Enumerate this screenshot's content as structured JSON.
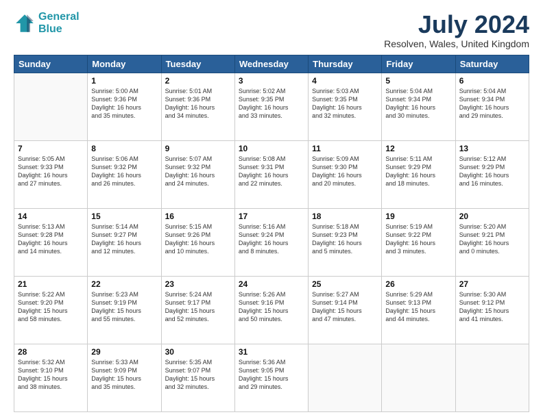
{
  "header": {
    "logo_line1": "General",
    "logo_line2": "Blue",
    "month": "July 2024",
    "location": "Resolven, Wales, United Kingdom"
  },
  "days_of_week": [
    "Sunday",
    "Monday",
    "Tuesday",
    "Wednesday",
    "Thursday",
    "Friday",
    "Saturday"
  ],
  "weeks": [
    [
      {
        "day": "",
        "content": ""
      },
      {
        "day": "1",
        "content": "Sunrise: 5:00 AM\nSunset: 9:36 PM\nDaylight: 16 hours\nand 35 minutes."
      },
      {
        "day": "2",
        "content": "Sunrise: 5:01 AM\nSunset: 9:36 PM\nDaylight: 16 hours\nand 34 minutes."
      },
      {
        "day": "3",
        "content": "Sunrise: 5:02 AM\nSunset: 9:35 PM\nDaylight: 16 hours\nand 33 minutes."
      },
      {
        "day": "4",
        "content": "Sunrise: 5:03 AM\nSunset: 9:35 PM\nDaylight: 16 hours\nand 32 minutes."
      },
      {
        "day": "5",
        "content": "Sunrise: 5:04 AM\nSunset: 9:34 PM\nDaylight: 16 hours\nand 30 minutes."
      },
      {
        "day": "6",
        "content": "Sunrise: 5:04 AM\nSunset: 9:34 PM\nDaylight: 16 hours\nand 29 minutes."
      }
    ],
    [
      {
        "day": "7",
        "content": "Sunrise: 5:05 AM\nSunset: 9:33 PM\nDaylight: 16 hours\nand 27 minutes."
      },
      {
        "day": "8",
        "content": "Sunrise: 5:06 AM\nSunset: 9:32 PM\nDaylight: 16 hours\nand 26 minutes."
      },
      {
        "day": "9",
        "content": "Sunrise: 5:07 AM\nSunset: 9:32 PM\nDaylight: 16 hours\nand 24 minutes."
      },
      {
        "day": "10",
        "content": "Sunrise: 5:08 AM\nSunset: 9:31 PM\nDaylight: 16 hours\nand 22 minutes."
      },
      {
        "day": "11",
        "content": "Sunrise: 5:09 AM\nSunset: 9:30 PM\nDaylight: 16 hours\nand 20 minutes."
      },
      {
        "day": "12",
        "content": "Sunrise: 5:11 AM\nSunset: 9:29 PM\nDaylight: 16 hours\nand 18 minutes."
      },
      {
        "day": "13",
        "content": "Sunrise: 5:12 AM\nSunset: 9:29 PM\nDaylight: 16 hours\nand 16 minutes."
      }
    ],
    [
      {
        "day": "14",
        "content": "Sunrise: 5:13 AM\nSunset: 9:28 PM\nDaylight: 16 hours\nand 14 minutes."
      },
      {
        "day": "15",
        "content": "Sunrise: 5:14 AM\nSunset: 9:27 PM\nDaylight: 16 hours\nand 12 minutes."
      },
      {
        "day": "16",
        "content": "Sunrise: 5:15 AM\nSunset: 9:26 PM\nDaylight: 16 hours\nand 10 minutes."
      },
      {
        "day": "17",
        "content": "Sunrise: 5:16 AM\nSunset: 9:24 PM\nDaylight: 16 hours\nand 8 minutes."
      },
      {
        "day": "18",
        "content": "Sunrise: 5:18 AM\nSunset: 9:23 PM\nDaylight: 16 hours\nand 5 minutes."
      },
      {
        "day": "19",
        "content": "Sunrise: 5:19 AM\nSunset: 9:22 PM\nDaylight: 16 hours\nand 3 minutes."
      },
      {
        "day": "20",
        "content": "Sunrise: 5:20 AM\nSunset: 9:21 PM\nDaylight: 16 hours\nand 0 minutes."
      }
    ],
    [
      {
        "day": "21",
        "content": "Sunrise: 5:22 AM\nSunset: 9:20 PM\nDaylight: 15 hours\nand 58 minutes."
      },
      {
        "day": "22",
        "content": "Sunrise: 5:23 AM\nSunset: 9:19 PM\nDaylight: 15 hours\nand 55 minutes."
      },
      {
        "day": "23",
        "content": "Sunrise: 5:24 AM\nSunset: 9:17 PM\nDaylight: 15 hours\nand 52 minutes."
      },
      {
        "day": "24",
        "content": "Sunrise: 5:26 AM\nSunset: 9:16 PM\nDaylight: 15 hours\nand 50 minutes."
      },
      {
        "day": "25",
        "content": "Sunrise: 5:27 AM\nSunset: 9:14 PM\nDaylight: 15 hours\nand 47 minutes."
      },
      {
        "day": "26",
        "content": "Sunrise: 5:29 AM\nSunset: 9:13 PM\nDaylight: 15 hours\nand 44 minutes."
      },
      {
        "day": "27",
        "content": "Sunrise: 5:30 AM\nSunset: 9:12 PM\nDaylight: 15 hours\nand 41 minutes."
      }
    ],
    [
      {
        "day": "28",
        "content": "Sunrise: 5:32 AM\nSunset: 9:10 PM\nDaylight: 15 hours\nand 38 minutes."
      },
      {
        "day": "29",
        "content": "Sunrise: 5:33 AM\nSunset: 9:09 PM\nDaylight: 15 hours\nand 35 minutes."
      },
      {
        "day": "30",
        "content": "Sunrise: 5:35 AM\nSunset: 9:07 PM\nDaylight: 15 hours\nand 32 minutes."
      },
      {
        "day": "31",
        "content": "Sunrise: 5:36 AM\nSunset: 9:05 PM\nDaylight: 15 hours\nand 29 minutes."
      },
      {
        "day": "",
        "content": ""
      },
      {
        "day": "",
        "content": ""
      },
      {
        "day": "",
        "content": ""
      }
    ]
  ]
}
